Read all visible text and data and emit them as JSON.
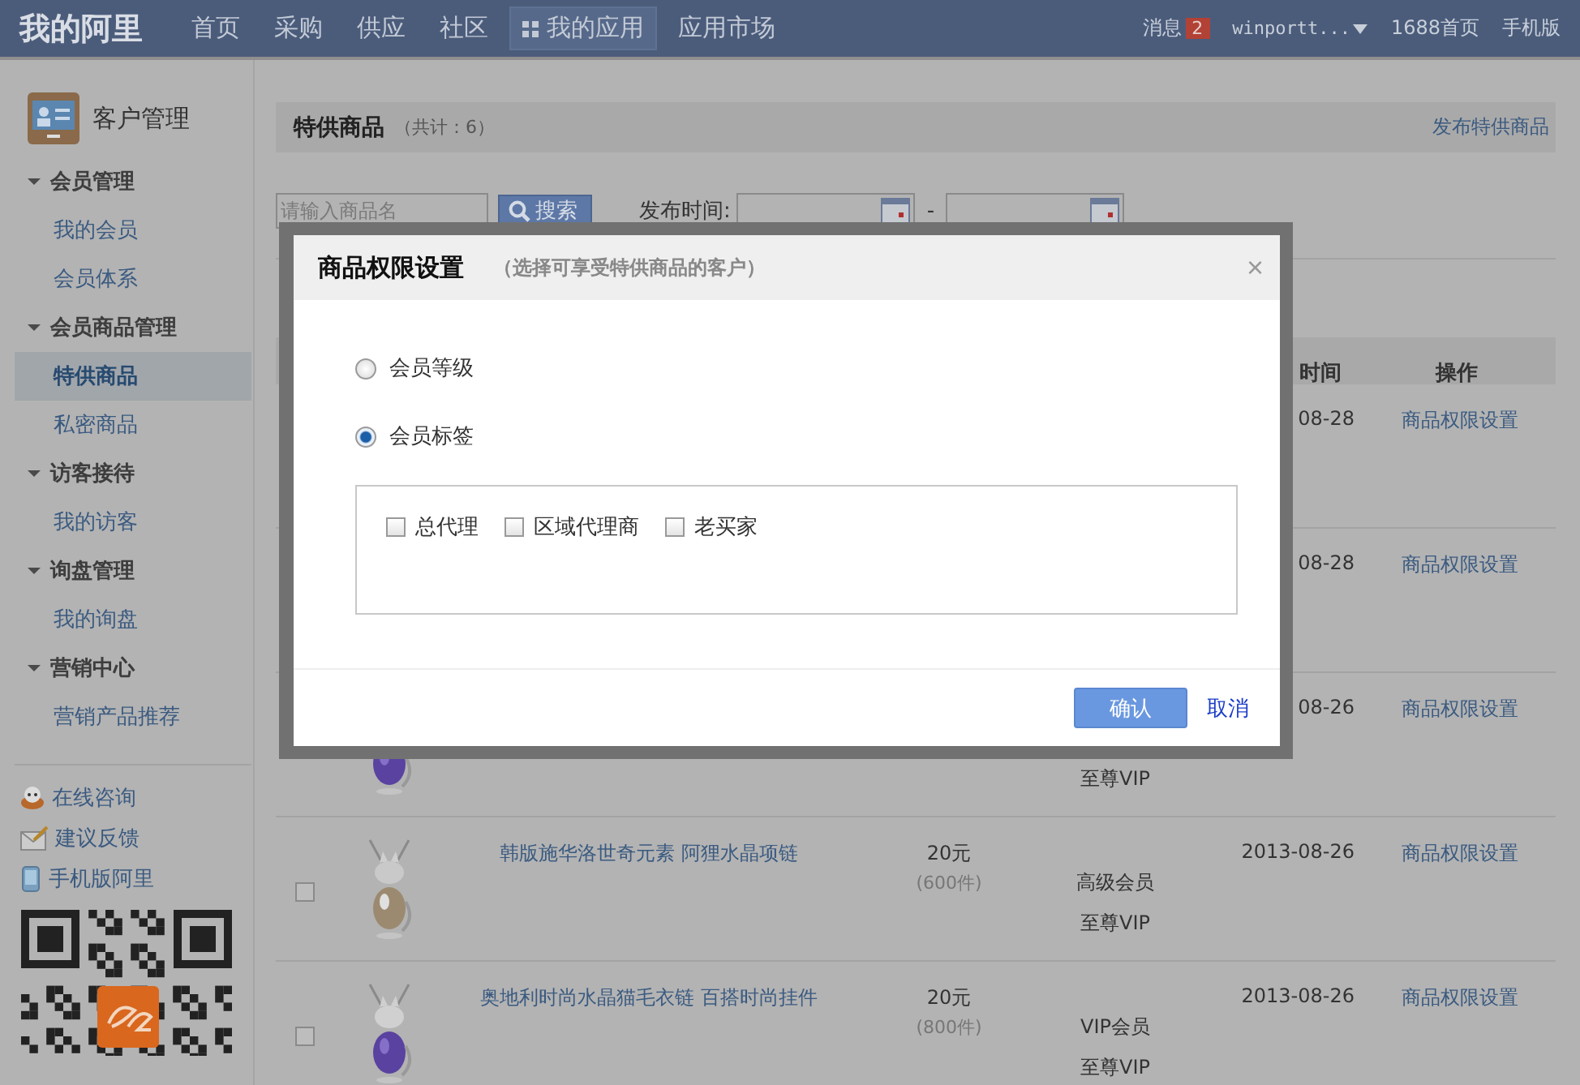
{
  "topbar": {
    "logo": "我的阿里",
    "nav": [
      {
        "label": "首页",
        "selected": false
      },
      {
        "label": "采购",
        "selected": false
      },
      {
        "label": "供应",
        "selected": false
      },
      {
        "label": "社区",
        "selected": false
      },
      {
        "label": "我的应用",
        "selected": true
      },
      {
        "label": "应用市场",
        "selected": false
      }
    ],
    "messages": {
      "label": "消息",
      "count": "2"
    },
    "user": "winportt...",
    "links": [
      "1688首页",
      "手机版"
    ]
  },
  "sidebar": {
    "title": "客户管理",
    "groups": [
      {
        "title": "会员管理",
        "expanded": true,
        "items": [
          {
            "label": "我的会员",
            "selected": false
          },
          {
            "label": "会员体系",
            "selected": false
          }
        ]
      },
      {
        "title": "会员商品管理",
        "expanded": true,
        "items": [
          {
            "label": "特供商品",
            "selected": true
          },
          {
            "label": "私密商品",
            "selected": false
          }
        ]
      },
      {
        "title": "访客接待",
        "expanded": true,
        "items": [
          {
            "label": "我的访客",
            "selected": false
          }
        ]
      },
      {
        "title": "询盘管理",
        "expanded": true,
        "items": [
          {
            "label": "我的询盘",
            "selected": false
          }
        ]
      },
      {
        "title": "营销中心",
        "expanded": true,
        "items": [
          {
            "label": "营销产品推荐",
            "selected": false
          }
        ]
      }
    ],
    "links": [
      {
        "label": "在线咨询",
        "kind": "consult"
      },
      {
        "label": "建议反馈",
        "kind": "feedback"
      },
      {
        "label": "手机版阿里",
        "kind": "mobile"
      }
    ]
  },
  "page": {
    "title": "特供商品",
    "count": "（共计：6）",
    "publish_link": "发布特供商品"
  },
  "filter": {
    "search_placeholder": "请输入商品名",
    "search_button": "搜索",
    "date_label": "发布时间:",
    "date_separator": "-"
  },
  "table": {
    "columns": {
      "time": "时间",
      "action": "操作"
    },
    "rows": [
      {
        "time": "08-28",
        "action": "商品权限设置"
      },
      {
        "time": "08-28",
        "action": "商品权限设置"
      },
      {
        "image": {
          "kind": "picture"
        },
        "member_levels": [
          "至尊VIP"
        ],
        "time": "08-26",
        "action": "商品权限设置"
      },
      {
        "checked": false,
        "image": {
          "kind": "picture"
        },
        "name": "韩版施华洛世奇元素 阿狸水晶项链",
        "price": "20元",
        "stock": "(600件)",
        "member_levels": [
          "高级会员",
          "至尊VIP"
        ],
        "time": "2013-08-26",
        "action": "商品权限设置"
      },
      {
        "checked": false,
        "image": {
          "kind": "picture"
        },
        "name": "奥地利时尚水晶猫毛衣链 百搭时尚挂件",
        "price": "20元",
        "stock": "(800件)",
        "member_levels": [
          "VIP会员",
          "至尊VIP"
        ],
        "time": "2013-08-26",
        "action": "商品权限设置"
      }
    ]
  },
  "dialog": {
    "title": "商品权限设置",
    "subtitle": "（选择可享受特供商品的客户）",
    "close": "×",
    "options": [
      {
        "label": "会员等级",
        "selected": false
      },
      {
        "label": "会员标签",
        "selected": true
      }
    ],
    "tags": [
      {
        "label": "总代理",
        "checked": false
      },
      {
        "label": "区域代理商",
        "checked": false
      },
      {
        "label": "老买家",
        "checked": false
      }
    ],
    "confirm": "确认",
    "cancel": "取消"
  }
}
